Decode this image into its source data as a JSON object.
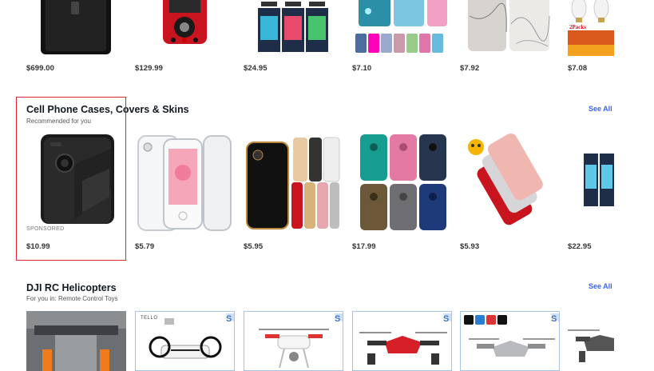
{
  "top_row": {
    "prices": [
      "$699.00",
      "$129.99",
      "$24.95",
      "$7.10",
      "$7.92",
      "$7.08"
    ],
    "icons": [
      "black-phone-image",
      "red-multimeter-image",
      "phone-case-packs-image",
      "glitter-cases-image",
      "marble-case-image",
      "led-bulbs-image"
    ],
    "badge_text": "2Packs"
  },
  "section1": {
    "title": "Cell Phone Cases, Covers & Skins",
    "subtitle": "Recommended for you",
    "see_all": "See All",
    "items": [
      {
        "price": "$10.99",
        "sponsored": "SPONSORED",
        "icon": "black-rugged-case-image"
      },
      {
        "price": "$5.79",
        "icon": "clear-case-image"
      },
      {
        "price": "$5.95",
        "icon": "color-cases-image"
      },
      {
        "price": "$17.99",
        "icon": "otterbox-cases-image"
      },
      {
        "price": "$5.93",
        "icon": "rose-gold-cases-image"
      },
      {
        "price": "$22.95",
        "icon": "case-pack-image"
      }
    ]
  },
  "section2": {
    "title": "DJI RC Helicopters",
    "subtitle": "For you in: Remote Control Toys",
    "see_all": "See All",
    "items": [
      {
        "icon": "orange-drone-image"
      },
      {
        "icon": "tello-drone-image",
        "label": "TELLO"
      },
      {
        "icon": "white-drone-image"
      },
      {
        "icon": "red-drone-image"
      },
      {
        "icon": "grey-drone-image"
      },
      {
        "icon": "dark-drone-image"
      }
    ]
  }
}
